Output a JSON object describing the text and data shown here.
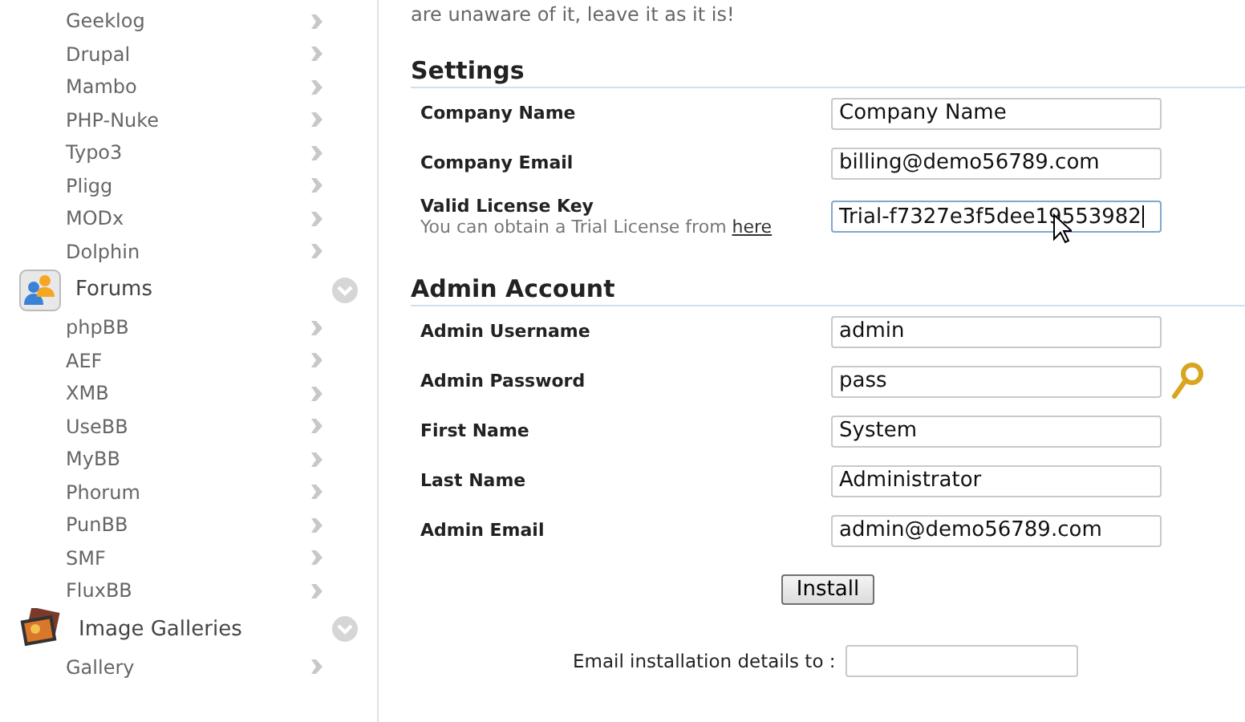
{
  "sidebar": {
    "items": [
      {
        "label": "Geeklog"
      },
      {
        "label": "Drupal"
      },
      {
        "label": "Mambo"
      },
      {
        "label": "PHP-Nuke"
      },
      {
        "label": "Typo3"
      },
      {
        "label": "Pligg"
      },
      {
        "label": "MODx"
      },
      {
        "label": "Dolphin"
      }
    ],
    "categories": [
      {
        "title": "Forums",
        "kind": "forums",
        "items": [
          {
            "label": "phpBB"
          },
          {
            "label": "AEF"
          },
          {
            "label": "XMB"
          },
          {
            "label": "UseBB"
          },
          {
            "label": "MyBB"
          },
          {
            "label": "Phorum"
          },
          {
            "label": "PunBB"
          },
          {
            "label": "SMF"
          },
          {
            "label": "FluxBB"
          }
        ]
      },
      {
        "title": "Image Galleries",
        "kind": "images",
        "items": [
          {
            "label": "Gallery"
          }
        ]
      }
    ]
  },
  "main": {
    "intro_text": "are unaware of it, leave it as it is!",
    "sections": [
      {
        "title": "Settings",
        "fields": [
          {
            "label": "Company Name",
            "value": "Company Name",
            "kind": "text",
            "focused": false
          },
          {
            "label": "Company Email",
            "value": "billing@demo56789.com",
            "kind": "text",
            "focused": false
          },
          {
            "label": "Valid License Key",
            "hint": "You can obtain a Trial License from",
            "hint_link": "here",
            "value": "Trial-f7327e3f5dee19553982",
            "kind": "text",
            "focused": true
          }
        ]
      },
      {
        "title": "Admin Account",
        "fields": [
          {
            "label": "Admin Username",
            "value": "admin",
            "kind": "text",
            "focused": false
          },
          {
            "label": "Admin Password",
            "value": "pass",
            "kind": "password",
            "focused": false
          },
          {
            "label": "First Name",
            "value": "System",
            "kind": "text",
            "focused": false
          },
          {
            "label": "Last Name",
            "value": "Administrator",
            "kind": "text",
            "focused": false
          },
          {
            "label": "Admin Email",
            "value": "admin@demo56789.com",
            "kind": "text",
            "focused": false
          }
        ]
      }
    ],
    "install_button": "Install",
    "email_details": {
      "label": "Email installation details to :"
    }
  }
}
